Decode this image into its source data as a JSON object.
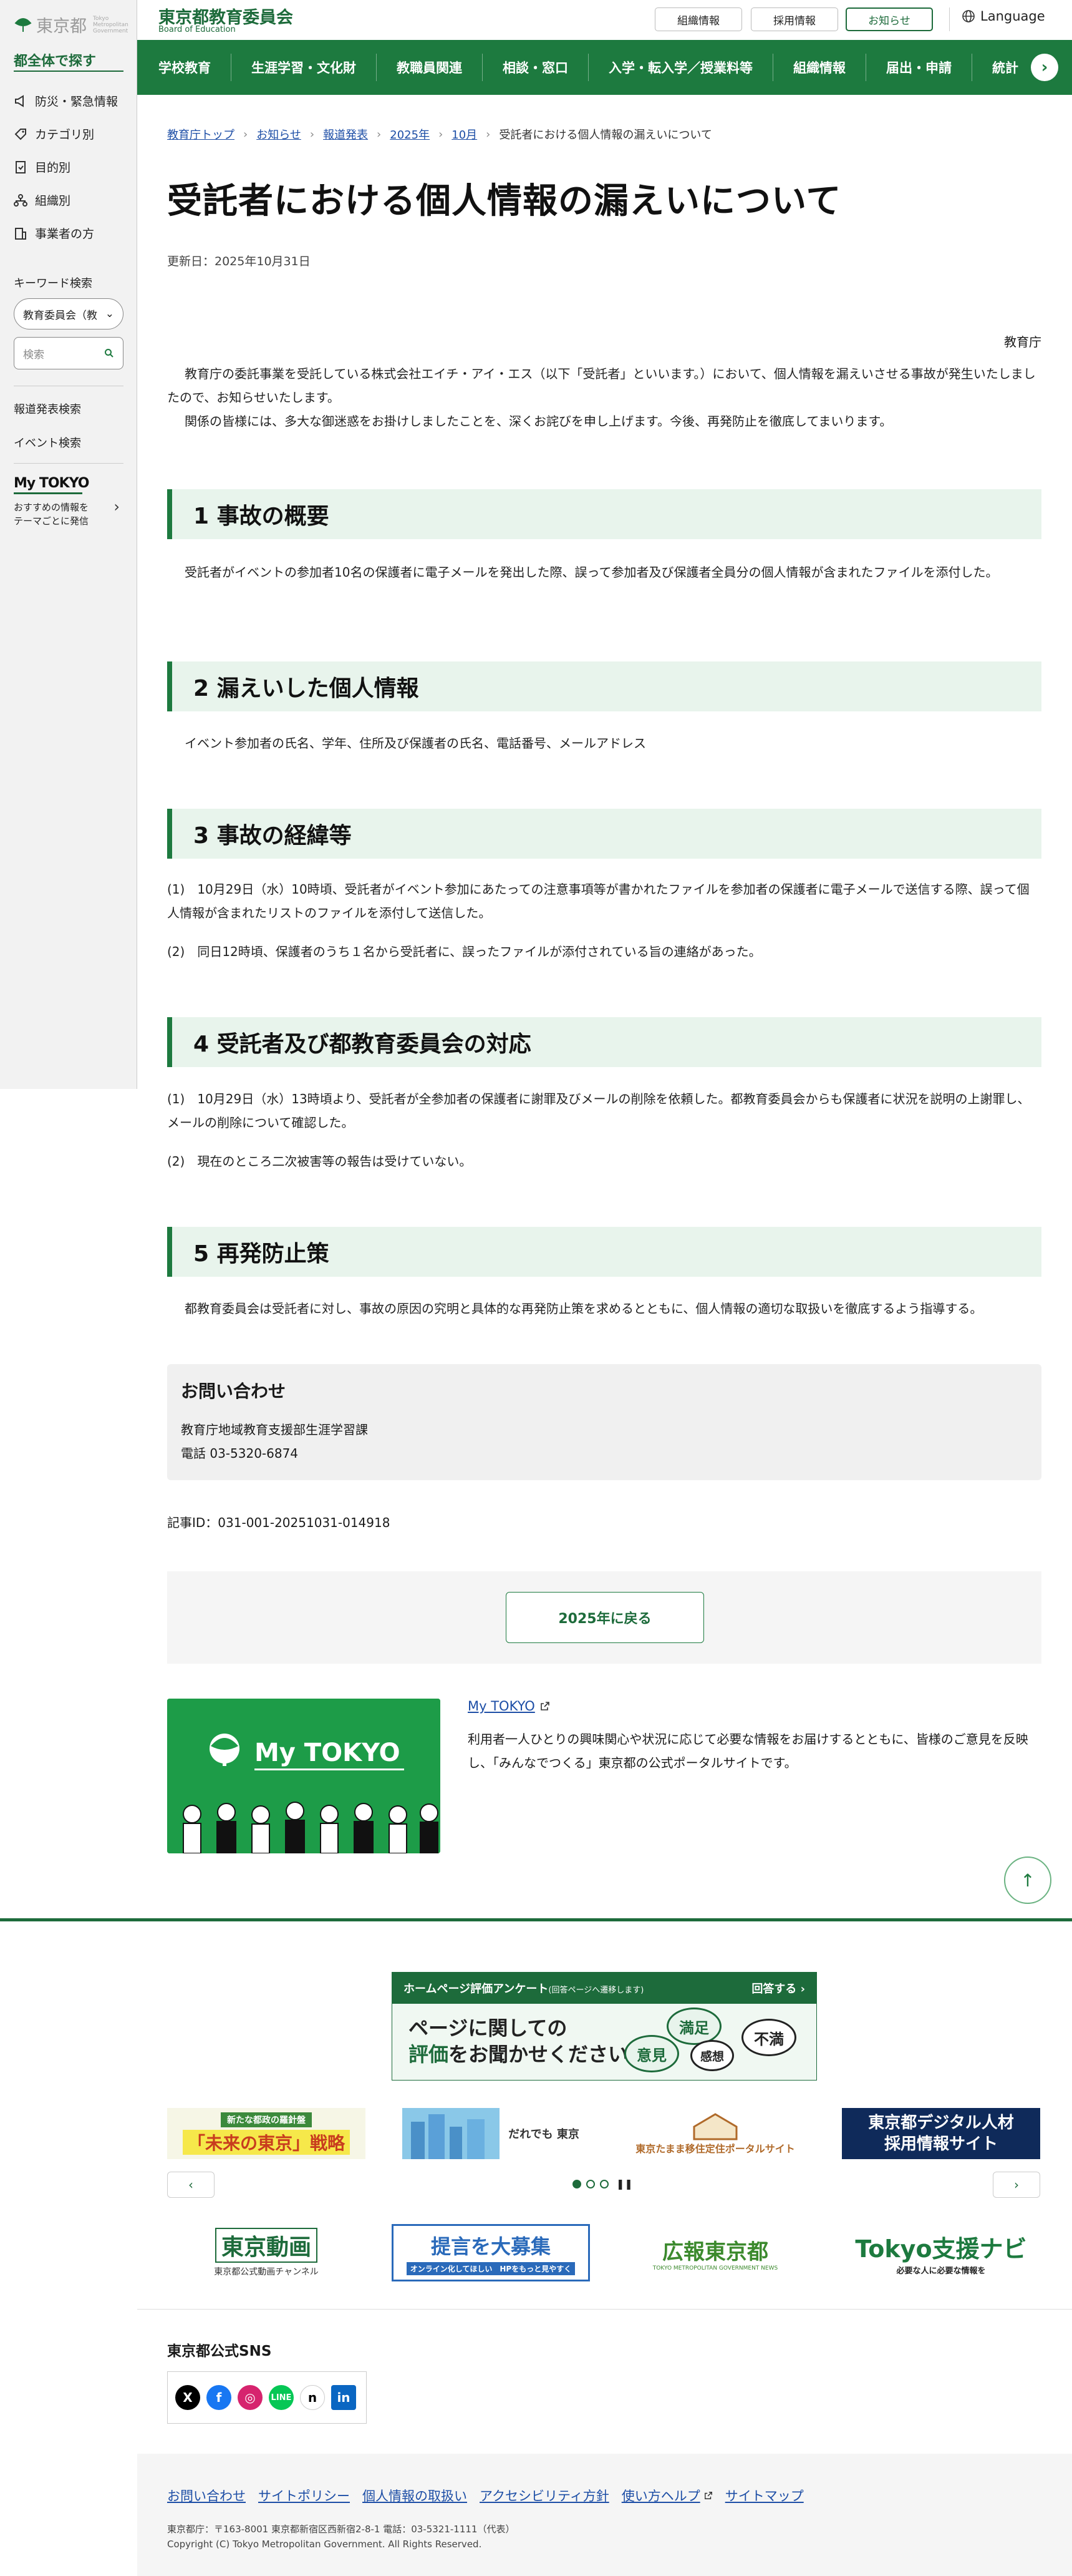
{
  "sidebar": {
    "logo_text": "東京都",
    "logo_sub": "Tokyo Metropolitan Government",
    "heading": "都全体で探す",
    "items": [
      {
        "label": "防災・緊急情報",
        "icon": "megaphone-icon"
      },
      {
        "label": "カテゴリ別",
        "icon": "tag-icon"
      },
      {
        "label": "目的別",
        "icon": "document-icon"
      },
      {
        "label": "組織別",
        "icon": "org-chart-icon"
      },
      {
        "label": "事業者の方",
        "icon": "building-icon"
      }
    ],
    "keyword_label": "キーワード検索",
    "scope_select": "教育委員会（教",
    "search_placeholder": "検索",
    "press_search": "報道発表検索",
    "event_search": "イベント検索",
    "mytokyo_logo": "My TOKYO",
    "mytokyo_text": "おすすめの情報を\nテーマごとに発信"
  },
  "header": {
    "title": "東京都教育委員会",
    "subtitle": "Board of Education",
    "btn_org": "組織情報",
    "btn_recruit": "採用情報",
    "btn_notice": "お知らせ",
    "language": "Language"
  },
  "nav": {
    "items": [
      "学校教育",
      "生涯学習・文化財",
      "教職員関連",
      "相談・窓口",
      "入学・転入学／授業料等",
      "組織情報",
      "届出・申請",
      "統計"
    ]
  },
  "breadcrumb": {
    "items": [
      "教育庁トップ",
      "お知らせ",
      "報道発表",
      "2025年",
      "10月"
    ],
    "current": "受託者における個人情報の漏えいについて"
  },
  "article": {
    "title": "受託者における個人情報の漏えいについて",
    "updated": "更新日：2025年10月31日",
    "dept": "教育庁",
    "intro1": "教育庁の委託事業を受託している株式会社エイチ・アイ・エス（以下「受託者」といいます。）において、個人情報を漏えいさせる事故が発生いたしましたので、お知らせいたします。",
    "intro2": "関係の皆様には、多大な御迷惑をお掛けしましたことを、深くお詫びを申し上げます。今後、再発防止を徹底してまいります。",
    "s1_title": "1 事故の概要",
    "s1_body": "受託者がイベントの参加者10名の保護者に電子メールを発出した際、誤って参加者及び保護者全員分の個人情報が含まれたファイルを添付した。",
    "s2_title": "2 漏えいした個人情報",
    "s2_body": "イベント参加者の氏名、学年、住所及び保護者の氏名、電話番号、メールアドレス",
    "s3_title": "3 事故の経緯等",
    "s3_p1": "(1)　10月29日（水）10時頃、受託者がイベント参加にあたっての注意事項等が書かれたファイルを参加者の保護者に電子メールで送信する際、誤って個人情報が含まれたリストのファイルを添付して送信した。",
    "s3_p2": "(2)　同日12時頃、保護者のうち１名から受託者に、誤ったファイルが添付されている旨の連絡があった。",
    "s4_title": "4 受託者及び都教育委員会の対応",
    "s4_p1": "(1)　10月29日（水）13時頃より、受託者が全参加者の保護者に謝罪及びメールの削除を依頼した。都教育委員会からも保護者に状況を説明の上謝罪し、メールの削除について確認した。",
    "s4_p2": "(2)　現在のところ二次被害等の報告は受けていない。",
    "s5_title": "5 再発防止策",
    "s5_body": "都教育委員会は受託者に対し、事故の原因の究明と具体的な再発防止策を求めるとともに、個人情報の適切な取扱いを徹底するよう指導する。",
    "contact_title": "お問い合わせ",
    "contact_dept": "教育庁地域教育支援部生涯学習課",
    "contact_tel": "電話 03-5320-6874",
    "article_id": "記事ID：031-001-20251031-014918",
    "back_label": "2025年に戻る"
  },
  "mytokyo": {
    "link": "My TOKYO",
    "banner_logo": "My TOKYO",
    "desc": "利用者一人ひとりの興味関心や状況に応じて必要な情報をお届けするとともに、皆様のご意見を反映し、「みんなでつくる」東京都の公式ポータルサイトです。"
  },
  "footer": {
    "survey_bar": "ホームページ評価アンケート",
    "survey_bar_sub": "(回答ページへ遷移します)",
    "survey_answer": "回答する ›",
    "survey_line1": "ページに関しての",
    "survey_line2a": "評価",
    "survey_line2b": "をお聞かせください",
    "bubble_satisfied": "満足",
    "bubble_opinion": "意見",
    "bubble_thoughts": "感想",
    "bubble_dissatisfied": "不満",
    "banner1_top": "新たな都政の羅針盤",
    "banner1_main": "「未来の東京」戦略",
    "banner2_text": "だれでも 東京",
    "banner3_text": "東京たまま移住定住ポータルサイト",
    "banner4_line1": "東京都デジタル人材",
    "banner4_line2": "採用情報サイト",
    "banner5_main": "東京動画",
    "banner5_sub": "東京都公式動画チャンネル",
    "banner6_main": "提言を大募集",
    "banner6_sub": "オンライン化してほしい　HPをもっと見やすく",
    "banner7_main": "広報東京都",
    "banner7_sub": "TOKYO METROPOLITAN GOVERNMENT NEWS",
    "banner8_main": "Tokyo支援ナビ",
    "banner8_sub": "必要な人に必要な情報を",
    "sns_title": "東京都公式SNS",
    "links": [
      "お問い合わせ",
      "サイトポリシー",
      "個人情報の取扱い",
      "アクセシビリティ方針",
      "使い方ヘルプ",
      "サイトマップ"
    ],
    "address": "東京都庁：〒163-8001 東京都新宿区西新宿2-8-1 電話：03-5321-1111（代表）",
    "copyright": "Copyright (C) Tokyo Metropolitan Government. All Rights Reserved."
  },
  "colors": {
    "brand_green": "#1d7a3f",
    "link_blue": "#1d4ea6",
    "section_bg": "#e8f4ec"
  }
}
